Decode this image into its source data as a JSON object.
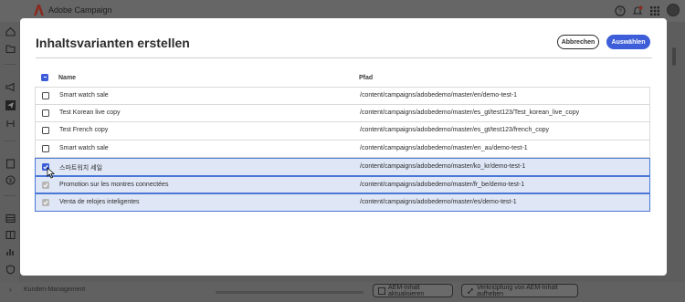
{
  "app": {
    "title": "Adobe Campaign"
  },
  "modal": {
    "title": "Inhaltsvarianten erstellen",
    "cancel_label": "Abbrechen",
    "select_label": "Auswählen"
  },
  "table": {
    "columns": [
      "Name",
      "Pfad"
    ],
    "rows": [
      {
        "name": "Smart watch sale",
        "path": "/content/campaigns/adobedemo/master/en/demo-test-1",
        "state": "unchecked"
      },
      {
        "name": "Test Korean live copy",
        "path": "/content/campaigns/adobedemo/master/es_gt/test123/Test_korean_live_copy",
        "state": "unchecked"
      },
      {
        "name": "Test French copy",
        "path": "/content/campaigns/adobedemo/master/es_gt/test123/french_copy",
        "state": "unchecked"
      },
      {
        "name": "Smart watch sale",
        "path": "/content/campaigns/adobedemo/master/en_au/demo-test-1",
        "state": "unchecked"
      },
      {
        "name": "스마트워치 세일",
        "path": "/content/campaigns/adobedemo/master/ko_kr/demo-test-1",
        "state": "checked"
      },
      {
        "name": "Promotion sur les montres connectées",
        "path": "/content/campaigns/adobedemo/master/fr_be/demo-test-1",
        "state": "checked-disabled"
      },
      {
        "name": "Venta de relojes inteligentes",
        "path": "/content/campaigns/adobedemo/master/es/demo-test-1",
        "state": "checked-disabled"
      }
    ]
  },
  "footer": {
    "breadcrumb": "Kunden-Management",
    "update_button": "AEM-Inhalt aktualisieren",
    "unlink_button": "Verknüpfung von AEM-Inhalt aufheben"
  },
  "colors": {
    "accent": "#3d5ed8",
    "selected_row_bg": "#dfe7f6",
    "overlay": "#5d5d5d"
  },
  "icons": {
    "top": [
      "help-icon",
      "bell-icon",
      "apps-grid-icon"
    ],
    "rail": [
      "home-icon",
      "folder-icon",
      "megaphone-icon",
      "send-icon",
      "flow-icon",
      "report-icon",
      "dollar-icon",
      "table-icon",
      "chart-icon",
      "shield-icon"
    ]
  }
}
